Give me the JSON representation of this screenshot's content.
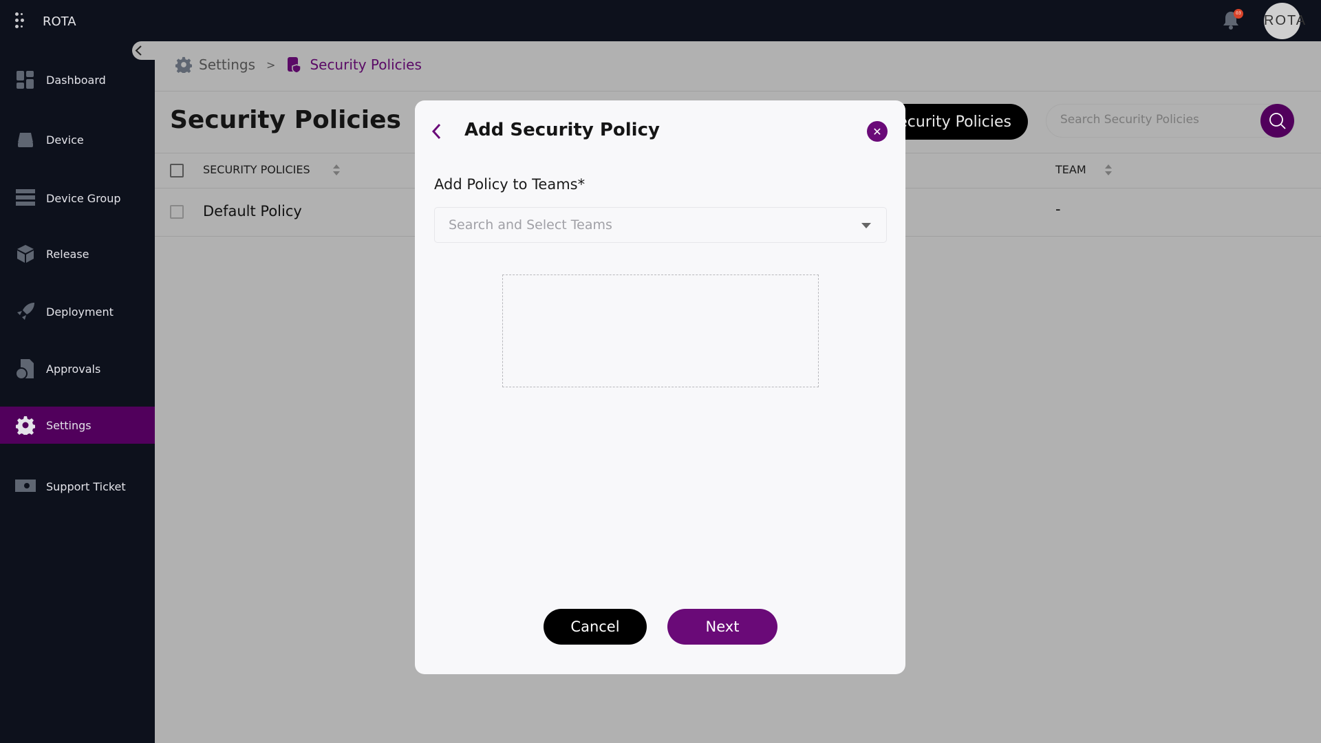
{
  "app": {
    "brand": "ROTA",
    "avatar_text": "ROTA",
    "notification_count": "03"
  },
  "sidebar": {
    "items": [
      {
        "label": "Dashboard",
        "icon": "dashboard-icon"
      },
      {
        "label": "Device",
        "icon": "device-icon"
      },
      {
        "label": "Device Group",
        "icon": "device-group-icon"
      },
      {
        "label": "Release",
        "icon": "release-box-icon"
      },
      {
        "label": "Deployment",
        "icon": "rocket-icon"
      },
      {
        "label": "Approvals",
        "icon": "approvals-doc-icon"
      },
      {
        "label": "Settings",
        "icon": "gear-icon",
        "active": true
      },
      {
        "label": "Support Ticket",
        "icon": "ticket-icon"
      }
    ]
  },
  "breadcrumb": {
    "parent": "Settings",
    "separator": ">",
    "current": "Security Policies"
  },
  "page": {
    "title": "Security Policies",
    "add_button": "Add Security Policies",
    "search_placeholder": "Search Security Policies"
  },
  "table": {
    "headers": [
      "SECURITY POLICIES",
      "TEAM"
    ],
    "rows": [
      {
        "name": "Default Policy",
        "team": "-"
      }
    ]
  },
  "modal": {
    "title": "Add Security Policy",
    "field_label": "Add Policy to Teams*",
    "select_placeholder": "Search and Select Teams",
    "cancel": "Cancel",
    "next": "Next"
  },
  "colors": {
    "accent": "#6a0a78",
    "sidebar_active": "#51005c",
    "sidebar_bg": "#0d111c"
  }
}
